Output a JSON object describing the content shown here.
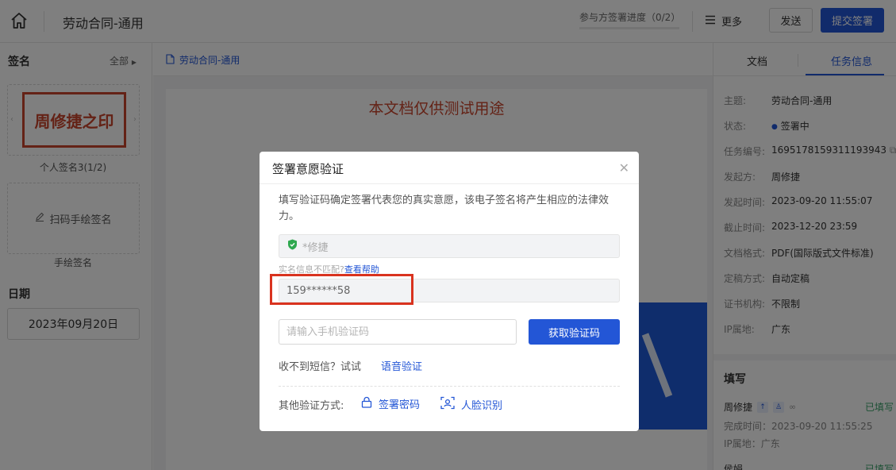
{
  "header": {
    "doc_title": "劳动合同-通用",
    "progress_text": "参与方签署进度（0/2）",
    "progress_value": 0,
    "more_label": "更多",
    "send_label": "发送",
    "submit_label": "提交签署"
  },
  "left": {
    "sign_title": "签名",
    "all_label": "全部",
    "seal_text": "周修捷之印",
    "seal_caption": "个人签名3(1/2)",
    "hand_sign_label": "扫码手绘签名",
    "hand_caption": "手绘签名",
    "date_title": "日期",
    "date_value": "2023年09月20日"
  },
  "doc": {
    "tab_label": "劳动合同-通用",
    "watermark": "本文档仅供测试用途"
  },
  "right": {
    "tabs": [
      "文档",
      "任务信息"
    ],
    "info": [
      {
        "k": "主题:",
        "v": "劳动合同-通用"
      },
      {
        "k": "状态:",
        "v": "签署中"
      },
      {
        "k": "任务编号:",
        "v": "1695178159311193943"
      },
      {
        "k": "发起方:",
        "v": "周修捷"
      },
      {
        "k": "发起时间:",
        "v": "2023-09-20 11:55:07"
      },
      {
        "k": "截止时间:",
        "v": "2023-12-20 23:59"
      },
      {
        "k": "文档格式:",
        "v": "PDF(国际版式文件标准)"
      },
      {
        "k": "定稿方式:",
        "v": "自动定稿"
      },
      {
        "k": "证书机构:",
        "v": "不限制"
      },
      {
        "k": "IP属地:",
        "v": "广东"
      }
    ],
    "fill_title": "填写",
    "fill_name": "周修捷",
    "fill_status": "已填写",
    "fill_done_time": "完成时间：2023-09-20 11:55:25",
    "fill_ip": "IP属地：广东",
    "next_name": "侯娟",
    "next_status": "已填写"
  },
  "dialog": {
    "title": "签署意愿验证",
    "description": "填写验证码确定签署代表您的真实意愿，该电子签名将产生相应的法律效力。",
    "name_value": "*修捷",
    "mismatch_text": "实名信息不匹配?",
    "mismatch_link": "查看帮助",
    "phone_value": "159******58",
    "code_placeholder": "请输入手机验证码",
    "get_code_label": "获取验证码",
    "no_sms_text": "收不到短信？试试",
    "voice_label": "语音验证",
    "other_label": "其他验证方式:",
    "password_label": "签署密码",
    "face_label": "人脸识别"
  },
  "colors": {
    "primary": "#2356d6",
    "seal_red": "#c8452c",
    "highlight_red": "#d9331f",
    "success": "#38a169"
  }
}
